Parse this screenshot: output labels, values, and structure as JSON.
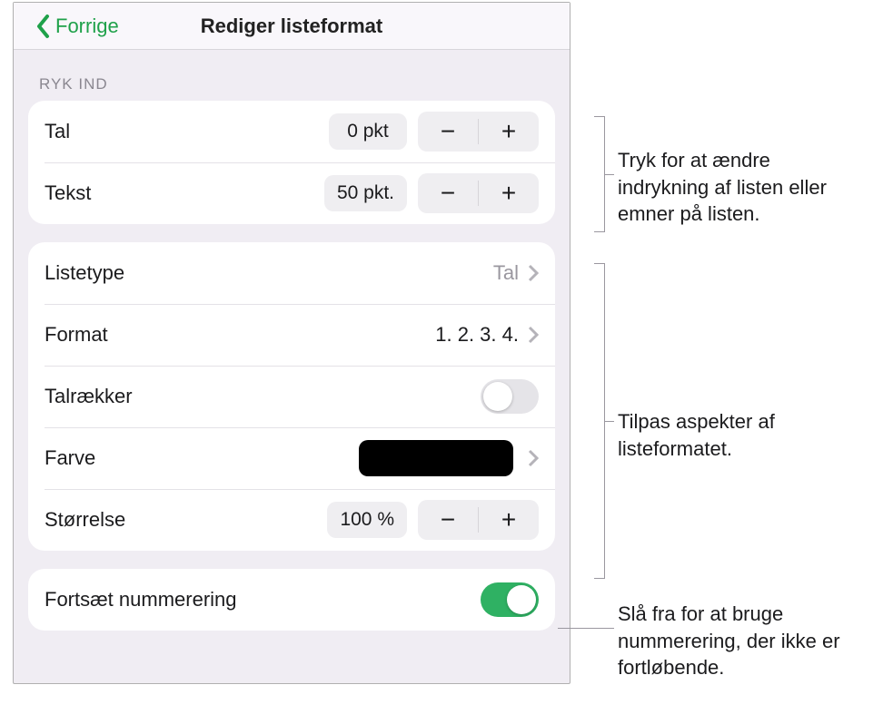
{
  "header": {
    "back_label": "Forrige",
    "title": "Rediger listeformat"
  },
  "sections": {
    "indent": {
      "heading": "RYK IND",
      "number": {
        "label": "Tal",
        "value": "0 pkt"
      },
      "text": {
        "label": "Tekst",
        "value": "50 pkt."
      }
    },
    "format": {
      "listtype": {
        "label": "Listetype",
        "value": "Tal"
      },
      "format": {
        "label": "Format",
        "value": "1. 2. 3. 4."
      },
      "tiers": {
        "label": "Talrækker",
        "on": false
      },
      "color": {
        "label": "Farve",
        "swatch": "#000000"
      },
      "size": {
        "label": "Størrelse",
        "value": "100 %"
      }
    },
    "continue": {
      "label": "Fortsæt nummerering",
      "on": true
    }
  },
  "glyphs": {
    "minus": "−",
    "plus": "+"
  },
  "callouts": {
    "indent": "Tryk for at ændre indrykning af listen eller emner på listen.",
    "format": "Tilpas aspekter af listeformatet.",
    "continue": "Slå fra for at bruge nummerering, der ikke er fortløbende."
  }
}
